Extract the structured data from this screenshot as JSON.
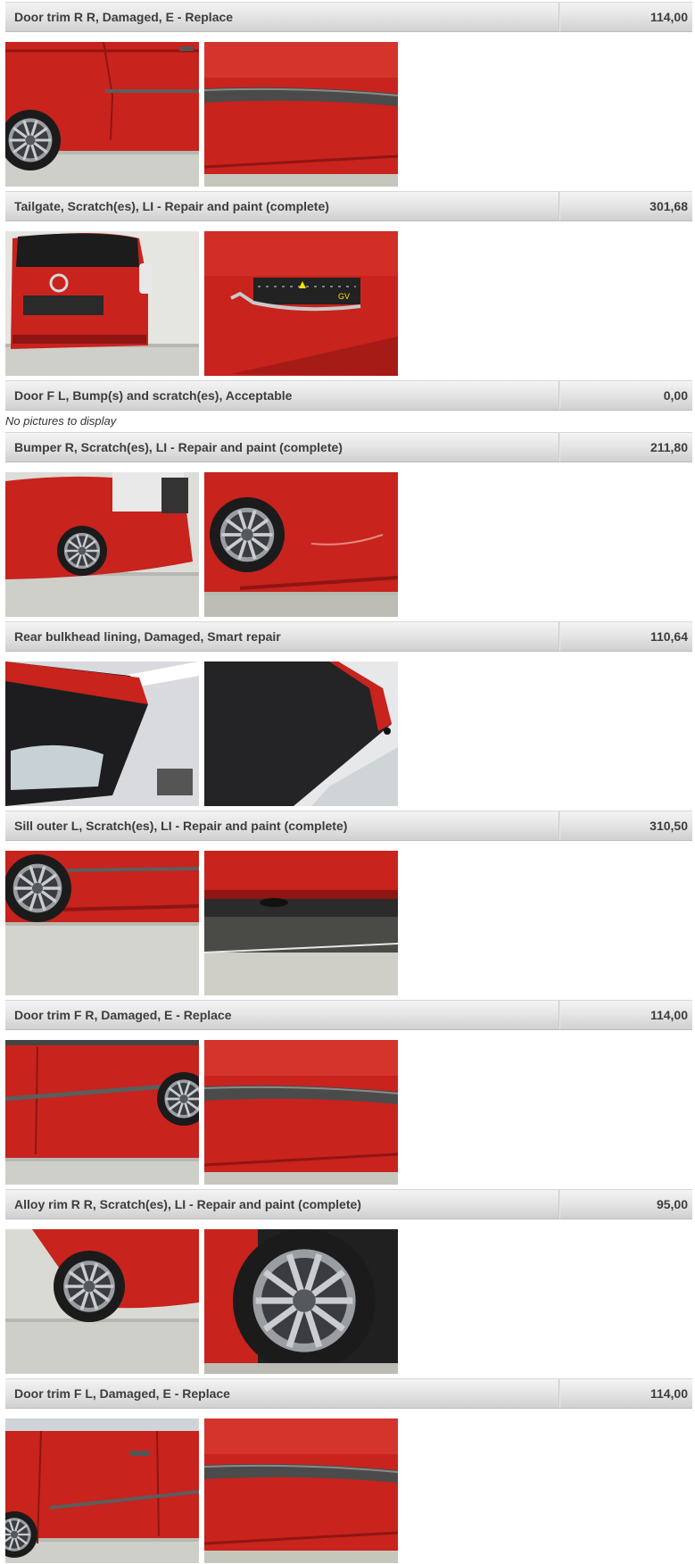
{
  "damage_items": [
    {
      "title": "Door trim R R, Damaged, E - Replace",
      "price": "114,00",
      "photos": [
        {
          "subject": "red-car-rear-door-side"
        },
        {
          "subject": "door-trim-closeup"
        }
      ]
    },
    {
      "title": "Tailgate, Scratch(es), LI - Repair and paint (complete)",
      "price": "301,68",
      "photos": [
        {
          "subject": "red-car-tailgate-rear"
        },
        {
          "subject": "tailgate-badge-with-gauge"
        }
      ]
    },
    {
      "title": "Door F L, Bump(s) and scratch(es), Acceptable",
      "price": "0,00",
      "photos": [],
      "no_pictures_text": "No pictures to display"
    },
    {
      "title": "Bumper R, Scratch(es), LI - Repair and paint (complete)",
      "price": "211,80",
      "photos": [
        {
          "subject": "red-car-rear-corner"
        },
        {
          "subject": "rear-bumper-wheel-closeup"
        }
      ]
    },
    {
      "title": "Rear bulkhead lining, Damaged, Smart repair",
      "price": "110,64",
      "photos": [
        {
          "subject": "open-tailgate-interior"
        },
        {
          "subject": "tailgate-lining-closeup"
        }
      ]
    },
    {
      "title": "Sill outer L, Scratch(es), LI - Repair and paint (complete)",
      "price": "310,50",
      "photos": [
        {
          "subject": "left-side-wheel-sill"
        },
        {
          "subject": "sill-underside-closeup"
        }
      ]
    },
    {
      "title": "Door trim F R, Damaged, E - Replace",
      "price": "114,00",
      "photos": [
        {
          "subject": "right-side-doors"
        },
        {
          "subject": "door-trim-closeup"
        }
      ]
    },
    {
      "title": "Alloy rim R R, Scratch(es), LI - Repair and paint (complete)",
      "price": "95,00",
      "photos": [
        {
          "subject": "rear-wheel-arch"
        },
        {
          "subject": "alloy-rim-closeup"
        }
      ]
    },
    {
      "title": "Door trim F L, Damaged, E - Replace",
      "price": "114,00",
      "photos": [
        {
          "subject": "front-left-door"
        },
        {
          "subject": "door-trim-closeup"
        }
      ]
    }
  ]
}
